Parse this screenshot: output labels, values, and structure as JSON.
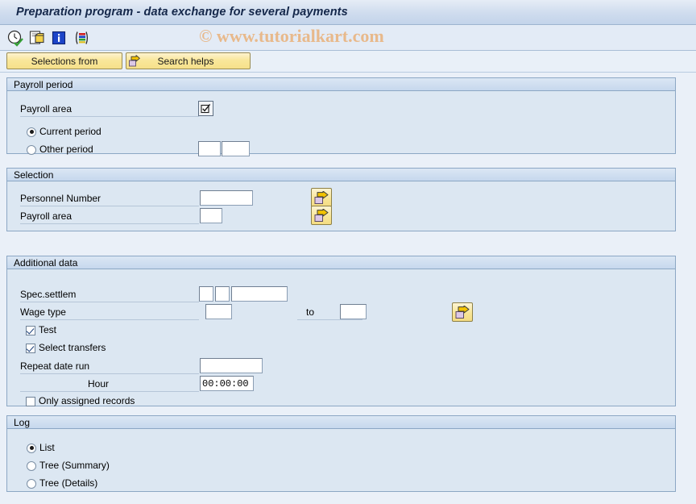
{
  "window": {
    "title": "Preparation program - data exchange for several payments"
  },
  "watermark": {
    "text": "© www.tutorialkart.com"
  },
  "toolbar": {
    "icons": [
      {
        "name": "execute-clock-check-icon",
        "tooltip": "Execute"
      },
      {
        "name": "execute-background-icon",
        "tooltip": "Execute in Background"
      },
      {
        "name": "info-icon",
        "tooltip": "Information"
      },
      {
        "name": "variant-bars-icon",
        "tooltip": "Get Variant"
      }
    ]
  },
  "buttons": {
    "selections_from": "Selections from",
    "search_helps": "Search helps"
  },
  "groups": {
    "payroll_period": {
      "title": "Payroll period",
      "payroll_area_label": "Payroll area",
      "payroll_area_value": "",
      "current_period_label": "Current period",
      "current_period_selected": true,
      "other_period_label": "Other period",
      "other_period_selected": false,
      "other_period_value_1": "",
      "other_period_value_2": ""
    },
    "selection": {
      "title": "Selection",
      "personnel_number_label": "Personnel Number",
      "personnel_number_value": "",
      "payroll_area_label": "Payroll area",
      "payroll_area_value": ""
    },
    "additional_data": {
      "title": "Additional data",
      "spec_settlem_label": "Spec.settlem",
      "spec_settlem_value_1": "",
      "spec_settlem_value_2": "",
      "spec_settlem_value_3": "",
      "wage_type_label": "Wage type",
      "wage_type_from": "",
      "wage_type_to_label": "to",
      "wage_type_to": "",
      "test_label": "Test",
      "test_checked": true,
      "select_transfers_label": "Select transfers",
      "select_transfers_checked": true,
      "repeat_date_run_label": "Repeat date run",
      "repeat_date_run_value": "",
      "hour_label": "Hour",
      "hour_value": "00:00:00",
      "only_assigned_records_label": "Only assigned records",
      "only_assigned_records_checked": false
    },
    "log": {
      "title": "Log",
      "list_label": "List",
      "list_selected": true,
      "tree_summary_label": "Tree (Summary)",
      "tree_summary_selected": false,
      "tree_details_label": "Tree (Details)",
      "tree_details_selected": false
    }
  },
  "colors": {
    "page_background": "#eaf0f8",
    "group_background": "#dce7f2",
    "group_header": "#c6d8ed",
    "button_yellow": "#f6e08a",
    "title_text": "#14274a",
    "watermark": "#e8b98b"
  }
}
